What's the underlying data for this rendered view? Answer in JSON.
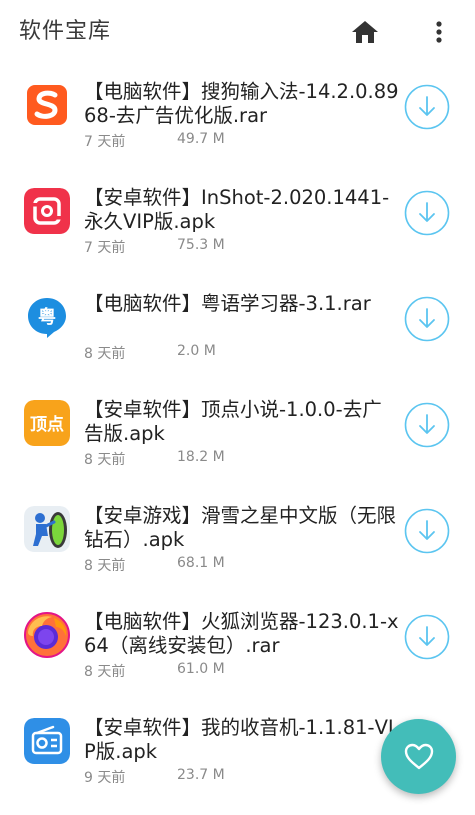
{
  "app": {
    "title": "软件宝库",
    "accent_color": "#43bdb9",
    "download_icon_color": "#5bc5f0"
  },
  "toolbar": {
    "home_icon": "home-icon",
    "more_icon": "more-vertical-icon"
  },
  "items": [
    {
      "title": "【电脑软件】搜狗输入法-14.2.0.8968-去广告优化版.rar",
      "date": "7 天前",
      "size": "49.7 M",
      "icon": "sogou-input-icon"
    },
    {
      "title": "【安卓软件】InShot-2.020.1441-永久VIP版.apk",
      "date": "7 天前",
      "size": "75.3 M",
      "icon": "inshot-icon"
    },
    {
      "title": "【电脑软件】粤语学习器-3.1.rar",
      "date": "8 天前",
      "size": "2.0 M",
      "icon": "cantonese-icon"
    },
    {
      "title": "【安卓软件】顶点小说-1.0.0-去广告版.apk",
      "date": "8 天前",
      "size": "18.2 M",
      "icon": "dingdian-novel-icon"
    },
    {
      "title": "【安卓游戏】滑雪之星中文版（无限钻石）.apk",
      "date": "8 天前",
      "size": "68.1 M",
      "icon": "ski-star-game-icon"
    },
    {
      "title": "【电脑软件】火狐浏览器-123.0.1-x64（离线安装包）.rar",
      "date": "8 天前",
      "size": "61.0 M",
      "icon": "firefox-icon"
    },
    {
      "title": "【安卓软件】我的收音机-1.1.81-VIP版.apk",
      "date": "9 天前",
      "size": "23.7 M",
      "icon": "radio-icon"
    }
  ],
  "fab": {
    "icon": "heart-icon"
  }
}
